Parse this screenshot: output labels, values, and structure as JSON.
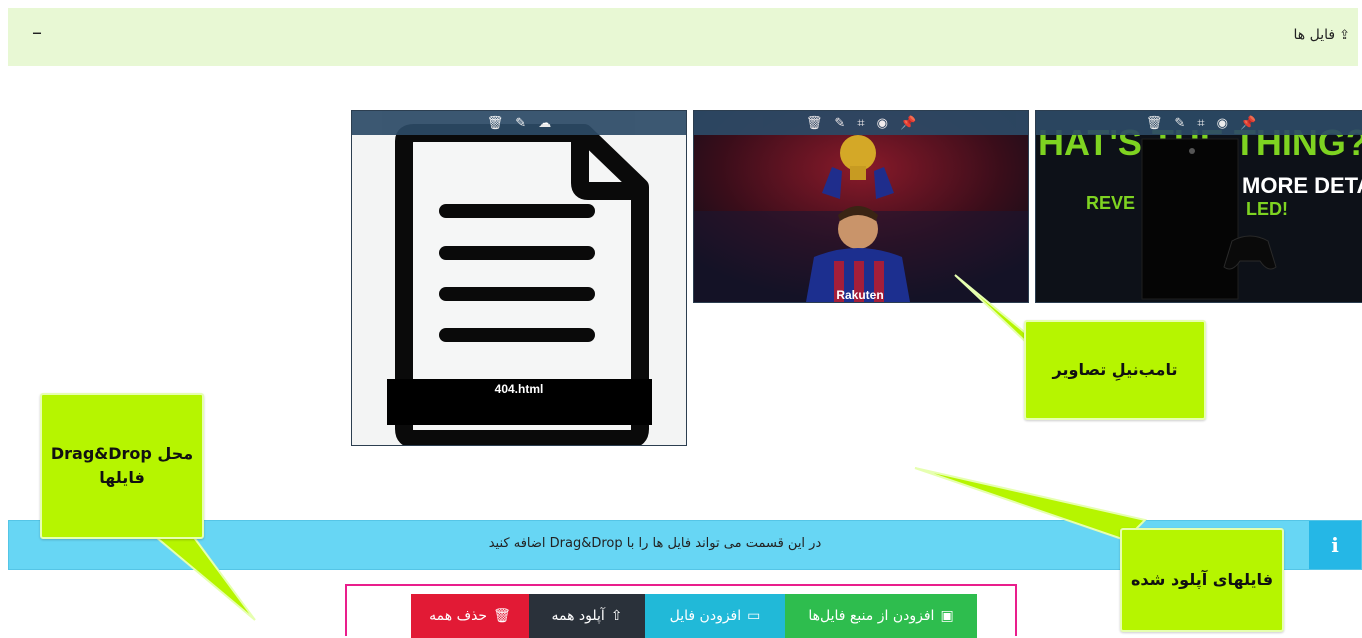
{
  "header": {
    "title": "فایل ها",
    "upload_icon": "cloud-upload-icon",
    "collapse_label": "–"
  },
  "files": [
    {
      "kind": "document",
      "filename": "404.html",
      "actions": [
        "trash-icon",
        "edit-icon",
        "cloud-download-icon"
      ]
    },
    {
      "kind": "image",
      "subject": "messi-trophy-photo",
      "shirt_text": "Rakuten",
      "actions": [
        "trash-icon",
        "edit-icon",
        "crop-icon",
        "eye-icon",
        "pin-icon"
      ]
    },
    {
      "kind": "image",
      "subject": "xbox-promo-image",
      "text_top": "HAT'S THE THING?",
      "text_mid": "MORE DETAILS",
      "text_side": "REVE",
      "text_side2": "LED!",
      "actions": [
        "trash-icon",
        "edit-icon",
        "crop-icon",
        "eye-icon",
        "pin-icon"
      ]
    }
  ],
  "dropzone": {
    "message": "در این قسمت می تواند فایل ها را با Drag&Drop اضافه کنید",
    "info_icon": "i"
  },
  "buttons": {
    "add_from_source": "افزودن از منبع فایل‌ها",
    "add_file": "افزودن فایل",
    "upload_all": "آپلود همه",
    "delete_all": "حذف همه"
  },
  "callouts": {
    "thumbnails": "تامب‌نیلِ تصاویر",
    "uploaded": "فایلهای آپلود شده",
    "dragdrop_line1": "محل Drag&Drop",
    "dragdrop_line2": "فایلها"
  },
  "colors": {
    "header_bg": "#e8f8d4",
    "info_bg": "#67d6f4",
    "callout_bg": "#b6f500",
    "green_btn": "#2ebd4e",
    "cyan_btn": "#21b9d8",
    "dark_btn": "#2a313a",
    "red_btn": "#e21a35"
  }
}
